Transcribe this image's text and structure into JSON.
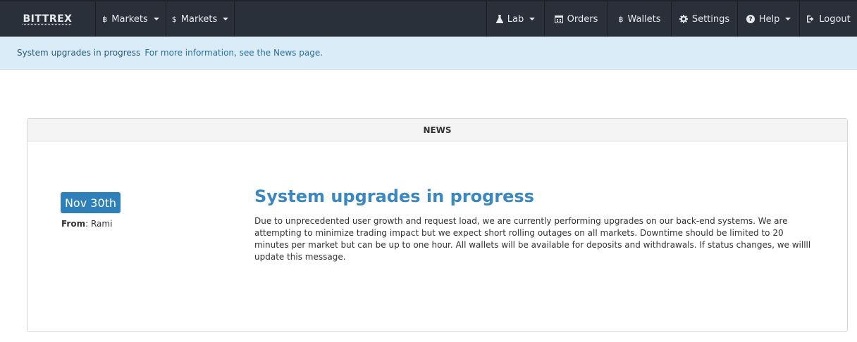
{
  "navbar": {
    "brand": "BITTREX",
    "left_items": [
      {
        "label": "Markets",
        "icon": "bitcoin-icon"
      },
      {
        "label": "Markets",
        "icon": "dollar-icon"
      }
    ],
    "right_items": [
      {
        "label": "Lab",
        "icon": "flask-icon"
      },
      {
        "label": "Orders",
        "icon": "calendar-icon"
      },
      {
        "label": "Wallets",
        "icon": "bitcoin-icon"
      },
      {
        "label": "Settings",
        "icon": "gear-icon"
      },
      {
        "label": "Help",
        "icon": "question-circle-icon"
      },
      {
        "label": "Logout",
        "icon": "logout-icon"
      }
    ],
    "icons": {
      "bitcoin": "฿",
      "dollar": "$"
    }
  },
  "alert": {
    "title": "System upgrades in progress",
    "link_text": "For more information, see the News page."
  },
  "news": {
    "heading": "NEWS",
    "date": "Nov 30th",
    "from_label": "From",
    "author": "Rami",
    "title": "System upgrades in progress",
    "body": "Due to unprecedented user growth and request load, we are currently performing upgrades on our back-end systems. We are attempting to minimize trading impact but we expect short rolling outages on all markets. Downtime should be limited to 20 minutes per market but can be up to one hour. All wallets will be available for deposits and withdrawals. If status changes, we willll update this message."
  },
  "colors": {
    "navbar_bg": "#2a3039",
    "alert_bg": "#d9ecf7",
    "accent": "#2f80b8",
    "title": "#3a88bf"
  }
}
